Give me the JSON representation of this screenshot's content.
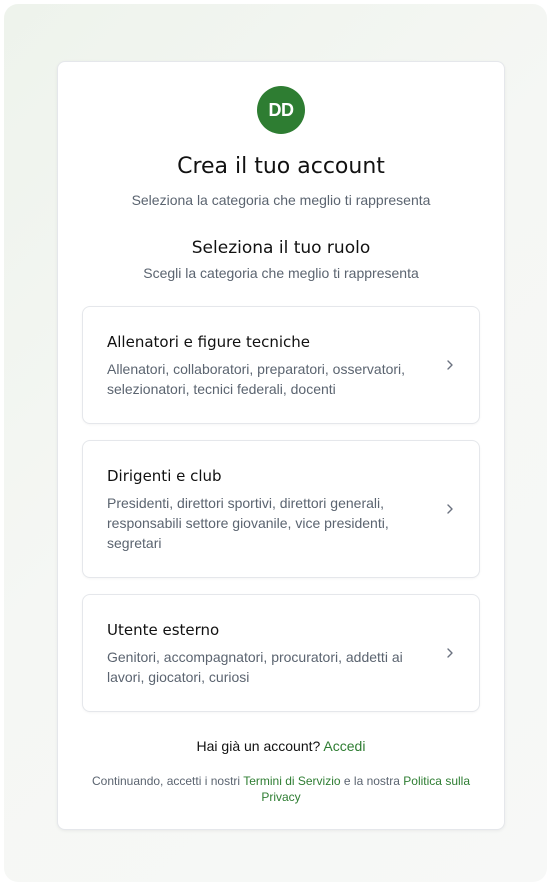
{
  "colors": {
    "accent": "#2e7d32",
    "muted_text": "#5b6470",
    "border": "#e5e7eb"
  },
  "header": {
    "avatar_initials": "DD",
    "title": "Crea il tuo account",
    "subtitle": "Seleziona la categoria che meglio ti rappresenta"
  },
  "section": {
    "title": "Seleziona il tuo ruolo",
    "subtitle": "Scegli la categoria che meglio ti rappresenta"
  },
  "roles": [
    {
      "title": "Allenatori e figure tecniche",
      "description": "Allenatori, collaboratori, preparatori, osservatori, selezionatori, tecnici federali, docenti",
      "icon": "chevron-right-icon"
    },
    {
      "title": "Dirigenti e club",
      "description": "Presidenti, direttori sportivi, direttori generali, responsabili settore giovanile, vice presidenti, segretari",
      "icon": "chevron-right-icon"
    },
    {
      "title": "Utente esterno",
      "description": "Genitori, accompagnatori, procuratori, addetti ai lavori, giocatori, curiosi",
      "icon": "chevron-right-icon"
    }
  ],
  "footer": {
    "login_prompt": "Hai già un account?",
    "login_link": "Accedi",
    "terms_prefix": "Continuando, accetti i nostri",
    "terms_link": "Termini di Servizio",
    "terms_middle": "e la nostra",
    "privacy_link": "Politica sulla Privacy"
  }
}
